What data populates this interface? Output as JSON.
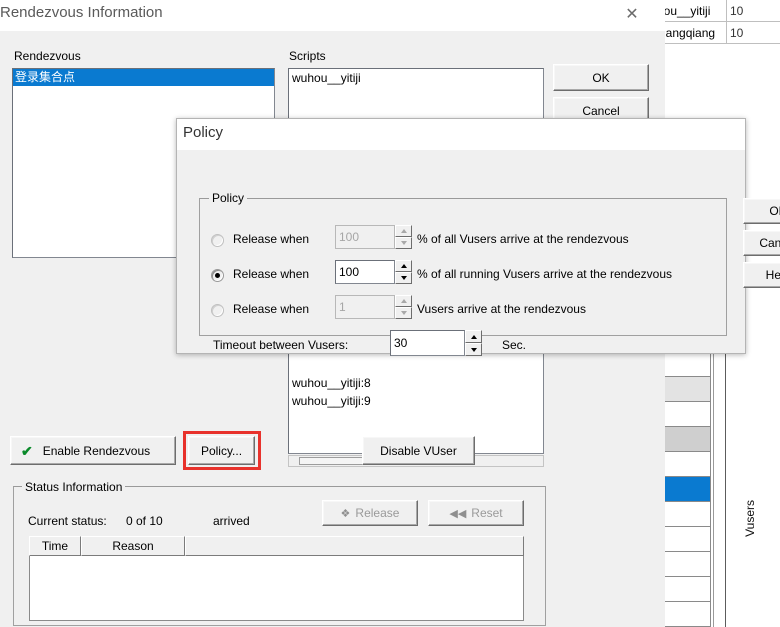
{
  "background_window": {
    "table_rows": [
      {
        "name": "hou__yitiji",
        "num": "10"
      },
      {
        "name": "xiangqiang",
        "num": "10"
      }
    ],
    "vertical_label": "Vusers",
    "selected_row_color": "#0a7ad0"
  },
  "rendezvous_window": {
    "title": "Rendezvous Information",
    "close_icon": "close-icon",
    "rendezvous_label": "Rendezvous",
    "rendezvous_items": [
      {
        "label": "登录集合点",
        "selected": true
      }
    ],
    "scripts_label": "Scripts",
    "scripts_items": [
      "wuhou__yitiji"
    ],
    "vusers_items": [
      "wuhou__yitiji:8",
      "wuhou__yitiji:9"
    ],
    "ok_label": "OK",
    "cancel_label": "Cancel",
    "enable_rendezvous_label": "Enable Rendezvous",
    "enable_rendezvous_check": "check-icon",
    "policy_button_label": "Policy...",
    "disable_vuser_label": "Disable VUser",
    "status": {
      "group_title": "Status Information",
      "current_status_label": "Current status:",
      "count_text": "0 of 10",
      "arrived_text": "arrived",
      "release_label": "Release",
      "reset_label": "Reset",
      "columns": [
        "Time",
        "Reason",
        ""
      ]
    },
    "highlight_color": "#e8322c"
  },
  "policy_dialog": {
    "title": "Policy",
    "group_title": "Policy",
    "options": [
      {
        "label": "Release when",
        "value": "100",
        "suffix": "% of all Vusers arrive at the rendezvous",
        "selected": false,
        "enabled": false
      },
      {
        "label": "Release when",
        "value": "100",
        "suffix": "% of all running Vusers arrive at the rendezvous",
        "selected": true,
        "enabled": true
      },
      {
        "label": "Release when",
        "value": "1",
        "suffix": "Vusers arrive at the rendezvous",
        "selected": false,
        "enabled": false
      }
    ],
    "timeout_label": "Timeout between Vusers:",
    "timeout_value": "30",
    "timeout_unit": "Sec.",
    "ok_label": "OK",
    "cancel_label": "Cancel",
    "help_label": "Help"
  }
}
